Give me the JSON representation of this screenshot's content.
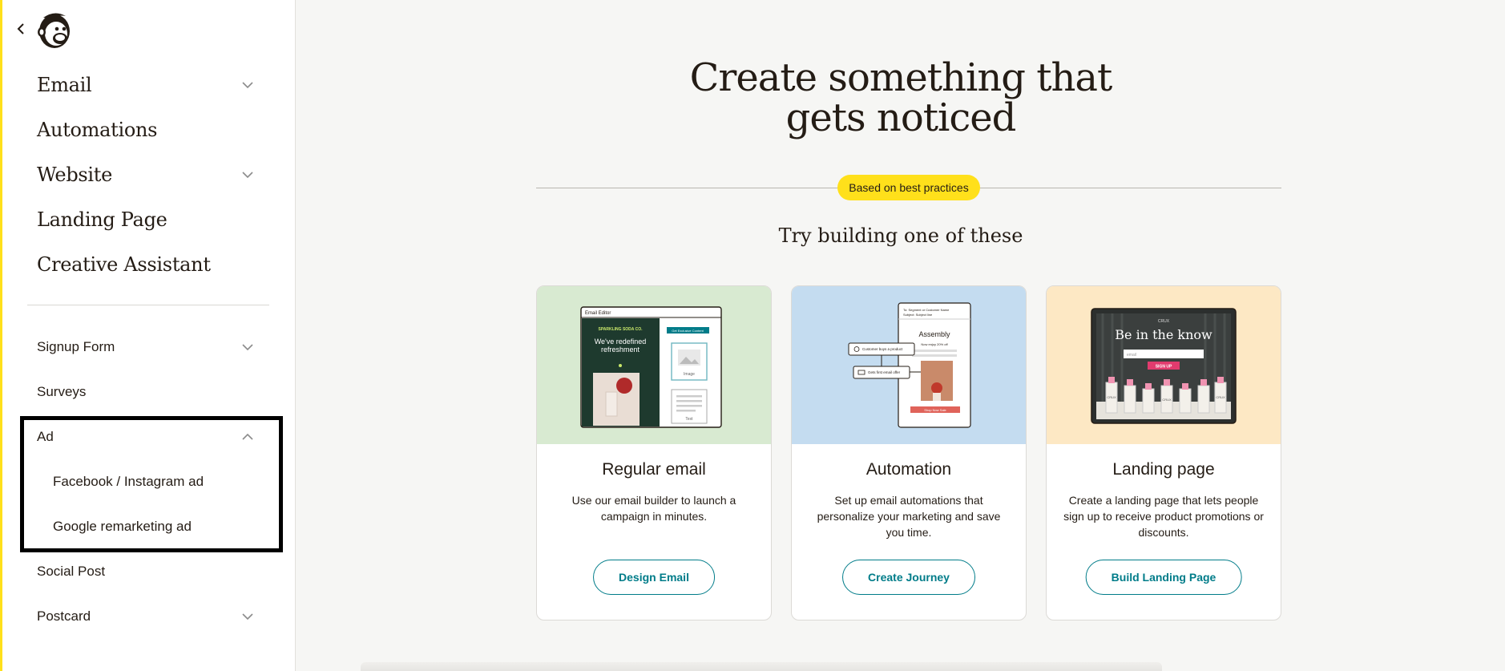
{
  "sidebar": {
    "back_icon": "chevron-left-icon",
    "logo_icon": "freddie-logo-icon",
    "primary": [
      {
        "label": "Email",
        "has_chevron": true
      },
      {
        "label": "Automations",
        "has_chevron": false
      },
      {
        "label": "Website",
        "has_chevron": true
      },
      {
        "label": "Landing Page",
        "has_chevron": false
      },
      {
        "label": "Creative Assistant",
        "has_chevron": false
      }
    ],
    "secondary": [
      {
        "label": "Signup Form",
        "chevron": "down"
      },
      {
        "label": "Surveys"
      },
      {
        "label": "Ad",
        "chevron": "up",
        "expanded": true
      },
      {
        "label": "Facebook / Instagram ad",
        "sub": true
      },
      {
        "label": "Google remarketing ad",
        "sub": true
      },
      {
        "label": "Social Post"
      },
      {
        "label": "Postcard",
        "chevron": "down"
      }
    ],
    "accent_color": "#ffe01b"
  },
  "main": {
    "title_line1": "Create something that",
    "title_line2": "gets noticed",
    "badge": "Based on best practices",
    "subtitle": "Try building one of these",
    "cards": [
      {
        "title": "Regular email",
        "description": "Use our email builder to launch a campaign in minutes.",
        "button": "Design Email",
        "bg": "#d8ead1",
        "thumb": {
          "header": "Email Editor",
          "brand": "SPARKLING SODA CO.",
          "headline1": "We've redefined",
          "headline2": "refreshment",
          "block_button": "Get Exclusive Content",
          "image_label": "Image",
          "text_label": "Text"
        }
      },
      {
        "title": "Automation",
        "description": "Set up email automations that personalize your marketing and save you time.",
        "button": "Create Journey",
        "bg": "#c4dcf0",
        "thumb": {
          "to_line": "To: Segment or Customer Name",
          "subject_line": "Subject: Subject line",
          "brand": "Assembly",
          "offer": "Now enjoy 20% off",
          "trigger1": "Customer buys a product",
          "trigger2": "Gets first email offer",
          "cta": "Shop Now Sale"
        }
      },
      {
        "title": "Landing page",
        "description": "Create a landing page that lets people sign up to receive product promotions or discounts.",
        "button": "Build Landing Page",
        "bg": "#fde8c4",
        "thumb": {
          "brand": "CRUX",
          "headline": "Be in the know",
          "input_placeholder": "email",
          "cta": "SIGN UP",
          "bottle_label": "CRUX"
        }
      }
    ],
    "link_color": "#007c89"
  }
}
